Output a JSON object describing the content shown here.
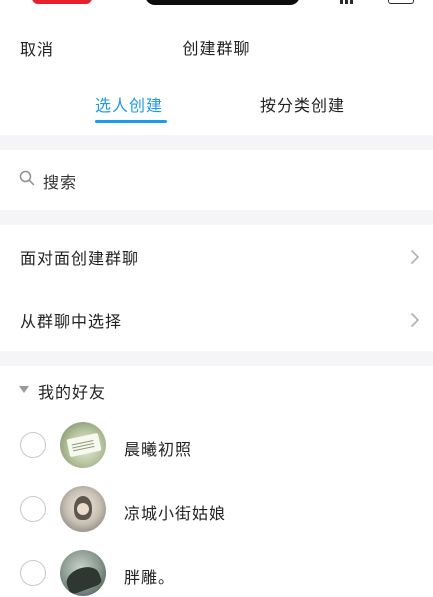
{
  "header": {
    "cancel_label": "取消",
    "title": "创建群聊"
  },
  "tabs": [
    {
      "label": "选人创建",
      "active": true
    },
    {
      "label": "按分类创建",
      "active": false
    }
  ],
  "search": {
    "label": "搜索",
    "icon": "search-icon"
  },
  "menu": [
    {
      "label": "面对面创建群聊",
      "icon": "chevron-right-icon"
    },
    {
      "label": "从群聊中选择",
      "icon": "chevron-right-icon"
    }
  ],
  "friends": {
    "section_title": "我的好友",
    "items": [
      {
        "name": "晨曦初照"
      },
      {
        "name": "凉城小街姑娘"
      },
      {
        "name": "胖雕。"
      }
    ]
  },
  "colors": {
    "accent": "#1f9ae8",
    "background": "#f5f5f7",
    "text": "#222222"
  }
}
